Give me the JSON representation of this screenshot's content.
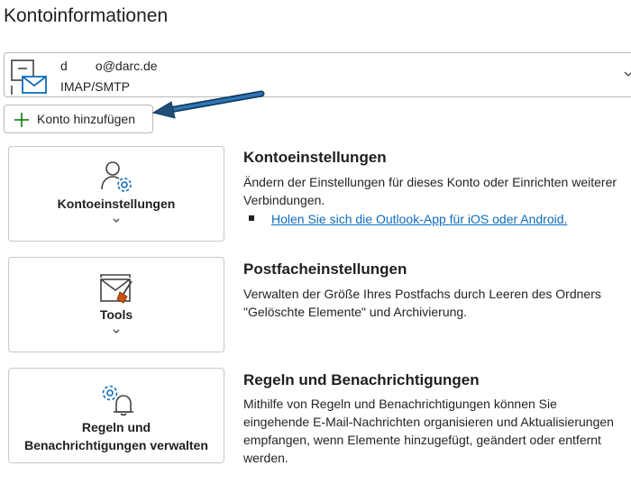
{
  "page": {
    "title": "Kontoinformationen"
  },
  "account": {
    "email": "d        o@darc.de",
    "type": "IMAP/SMTP",
    "icon": "mailbox-icon",
    "expand_icon": "chevron-down-icon"
  },
  "add_account": {
    "label": "Konto hinzufügen",
    "icon": "plus-icon"
  },
  "colors": {
    "accent": "#0f6cbd",
    "plus_green": "#107c10",
    "arrow": "#1f4e79"
  },
  "sections": [
    {
      "button_label": "Kontoeinstellungen",
      "button_icon": "account-settings-icon",
      "title": "Kontoeinstellungen",
      "description": "Ändern der Einstellungen für dieses Konto oder Einrichten weiterer Verbindungen.",
      "link": "Holen Sie sich die Outlook-App für iOS oder Android."
    },
    {
      "button_label": "Tools",
      "button_icon": "mailbox-cleanup-icon",
      "title": "Postfacheinstellungen",
      "description": "Verwalten der Größe Ihres Postfachs durch Leeren des Ordners \"Gelöschte Elemente\" und Archivierung."
    },
    {
      "button_label_line1": "Regeln und",
      "button_label_line2": "Benachrichtigungen verwalten",
      "button_icon": "rules-alerts-icon",
      "title": "Regeln und Benachrichtigungen",
      "description": "Mithilfe von Regeln und Benachrichtigungen können Sie eingehende E-Mail-Nachrichten organisieren und Aktualisierungen empfangen, wenn Elemente hinzugefügt, geändert oder entfernt werden."
    }
  ]
}
